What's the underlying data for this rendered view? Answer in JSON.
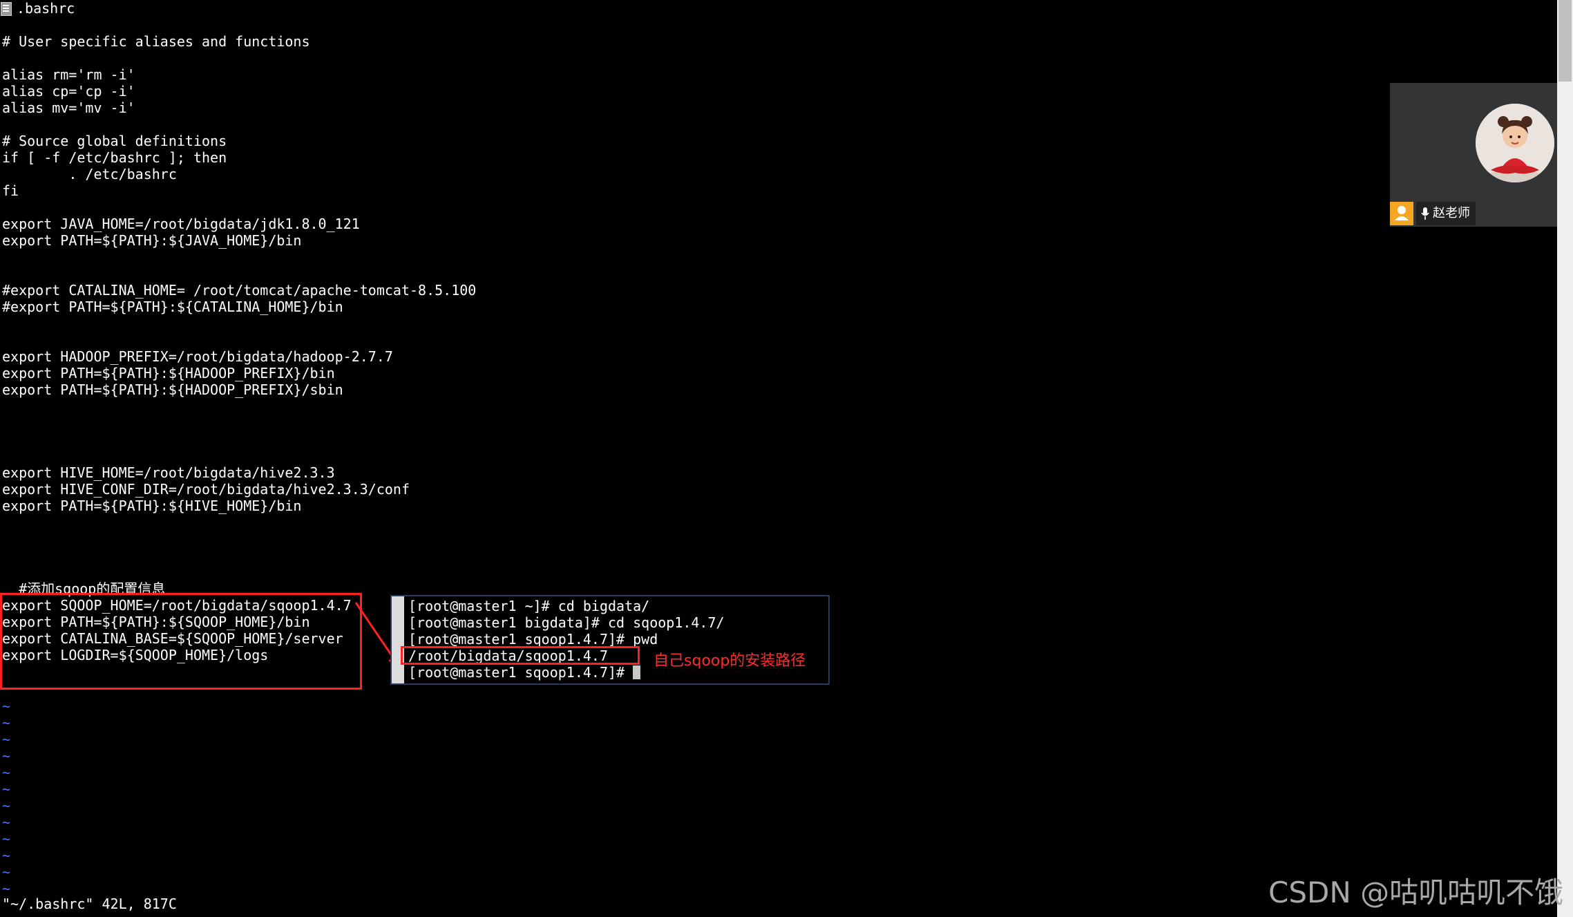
{
  "window": {
    "title": ".bashrc"
  },
  "editor": {
    "lines": [
      "",
      "# User specific aliases and functions",
      "",
      "alias rm='rm -i'",
      "alias cp='cp -i'",
      "alias mv='mv -i'",
      "",
      "# Source global definitions",
      "if [ -f /etc/bashrc ]; then",
      "        . /etc/bashrc",
      "fi",
      "",
      "export JAVA_HOME=/root/bigdata/jdk1.8.0_121",
      "export PATH=${PATH}:${JAVA_HOME}/bin",
      "",
      "",
      "#export CATALINA_HOME= /root/tomcat/apache-tomcat-8.5.100",
      "#export PATH=${PATH}:${CATALINA_HOME}/bin",
      "",
      "",
      "export HADOOP_PREFIX=/root/bigdata/hadoop-2.7.7",
      "export PATH=${PATH}:${HADOOP_PREFIX}/bin",
      "export PATH=${PATH}:${HADOOP_PREFIX}/sbin",
      "",
      "",
      "",
      "",
      "export HIVE_HOME=/root/bigdata/hive2.3.3",
      "export HIVE_CONF_DIR=/root/bigdata/hive2.3.3/conf",
      "export PATH=${PATH}:${HIVE_HOME}/bin",
      "",
      "",
      "",
      "",
      "  #添加sqoop的配置信息",
      "export SQOOP_HOME=/root/bigdata/sqoop1.4.7",
      "export PATH=${PATH}:${SQOOP_HOME}/bin",
      "export CATALINA_BASE=${SQOOP_HOME}/server",
      "export LOGDIR=${SQOOP_HOME}/logs"
    ],
    "tilde": "~",
    "status_line": "\"~/.bashrc\" 42L, 817C"
  },
  "inset_terminal": {
    "lines": [
      "[root@master1 ~]# cd bigdata/",
      "[root@master1 bigdata]# cd sqoop1.4.7/",
      "[root@master1 sqoop1.4.7]# pwd",
      "/root/bigdata/sqoop1.4.7",
      "[root@master1 sqoop1.4.7]# "
    ]
  },
  "annotation": {
    "text": "自己sqoop的安装路径",
    "color": "#ff2a2a"
  },
  "video_panel": {
    "name": "赵老师",
    "badge_color": "#f5a623"
  },
  "watermark": {
    "text": "CSDN @咕叽咕叽不饿"
  },
  "icons": {
    "file": "file-icon",
    "user": "user-icon",
    "mic": "microphone-icon",
    "arrow": "arrow-icon"
  }
}
